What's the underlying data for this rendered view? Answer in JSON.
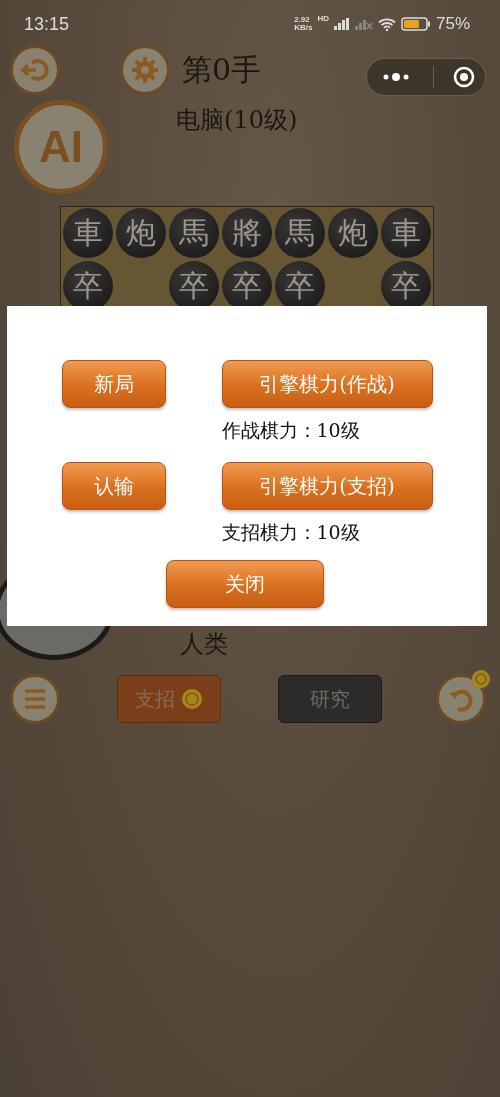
{
  "status_bar": {
    "time": "13:15",
    "speed": "2.92",
    "speed_unit": "KB/s",
    "network": "HD",
    "battery": "75%"
  },
  "header": {
    "move_title": "第0手",
    "opponent": "电脑(10级)",
    "ai_badge": "AI"
  },
  "board": {
    "rows": [
      [
        {
          "kind": "piece",
          "label": "車"
        },
        {
          "kind": "piece",
          "label": "炮"
        },
        {
          "kind": "piece",
          "label": "馬"
        },
        {
          "kind": "piece",
          "label": "將"
        },
        {
          "kind": "piece",
          "label": "馬"
        },
        {
          "kind": "piece",
          "label": "炮"
        },
        {
          "kind": "piece",
          "label": "車"
        }
      ],
      [
        {
          "kind": "piece",
          "label": "卒"
        },
        {
          "kind": "empty"
        },
        {
          "kind": "piece",
          "label": "卒"
        },
        {
          "kind": "piece",
          "label": "卒"
        },
        {
          "kind": "piece",
          "label": "卒"
        },
        {
          "kind": "empty"
        },
        {
          "kind": "piece",
          "label": "卒"
        }
      ]
    ]
  },
  "player": {
    "name": "人类"
  },
  "bottom_bar": {
    "hint_button": "支招",
    "research_button": "研究"
  },
  "dialog": {
    "new_game": "新局",
    "resign": "认输",
    "battle_strength_button": "引擎棋力(作战)",
    "battle_strength": "作战棋力：10级",
    "hint_strength_button": "引擎棋力(支招)",
    "hint_strength": "支招棋力：10级",
    "close": "关闭"
  }
}
